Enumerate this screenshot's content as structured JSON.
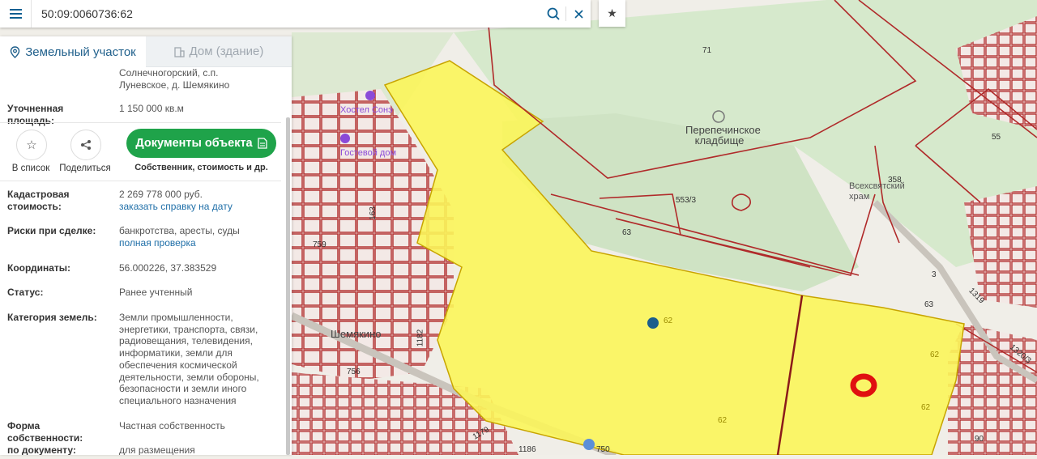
{
  "search": {
    "value": "50:09:0060736:62",
    "placeholder": ""
  },
  "icons": {
    "menu": "menu-icon",
    "search": "search-icon",
    "clear": "close-icon",
    "favorite": "star-icon",
    "share": "share-icon",
    "document": "document-icon",
    "pin": "location-pin-icon",
    "building": "building-icon"
  },
  "colors": {
    "accent": "#1f5f8b",
    "green_button": "#1fa34a",
    "parcel_fill": "#fbf55a",
    "cadastral_lines": "#b02a2a",
    "marker": "#e01010"
  },
  "tabs": [
    {
      "label": "Земельный участок",
      "active": true
    },
    {
      "label": "Дом (здание)",
      "active": false
    }
  ],
  "info": {
    "address_tail": "Солнечногорский, с.п. Луневское, д. Шемякино",
    "area_label": "Уточненная площадь:",
    "area_value": "1 150 000 кв.м"
  },
  "actions": {
    "add_list": "В список",
    "share": "Поделиться",
    "docs_button": "Документы объекта",
    "docs_sub": "Собственник, стоимость и др."
  },
  "fields": [
    {
      "label": "Кадастровая стоимость:",
      "value": "2 269 778 000 руб.",
      "link": "заказать справку на дату"
    },
    {
      "label": "Риски при сделке:",
      "value": "банкротства, аресты, суды",
      "link": "полная проверка"
    },
    {
      "label": "Координаты:",
      "value": "56.000226, 37.383529"
    },
    {
      "label": "Статус:",
      "value": "Ранее учтенный"
    },
    {
      "label": "Категория земель:",
      "value": "Земли промышленности, энергетики, транспорта, связи, радиовещания, телевидения, информатики, земли для обеспечения космической деятельности, земли обороны, безопасности и земли иного специального назначения"
    },
    {
      "label": "Форма собственности:",
      "value": "Частная собственность"
    },
    {
      "label": "по документу:",
      "value": "для размещения промышленных"
    }
  ],
  "map_labels": {
    "cemetery": "Перепечинское кладбище",
    "village": "Шемякино",
    "shop": "Всехсвятский храм",
    "parcel_71": "71",
    "parcel_553": "553/3",
    "parcel_63a": "63",
    "parcel_63b": "63",
    "parcel_62a": "62",
    "parcel_62b": "62",
    "parcel_62c": "62",
    "parcel_62d": "62",
    "parcel_55": "55",
    "parcel_358": "358",
    "parcel_1182": "1182",
    "parcel_1319": "1319",
    "parcel_1320": "1320/3",
    "parcel_90": "90",
    "parcel_750": "750",
    "parcel_1186": "1186",
    "parcel_1179": "1179",
    "parcel_756": "756",
    "parcel_759": "759",
    "parcel_163": "163",
    "parcel_3": "3",
    "poi_1": "Хостел Сонэ",
    "poi_2": "Гостевой дом"
  }
}
